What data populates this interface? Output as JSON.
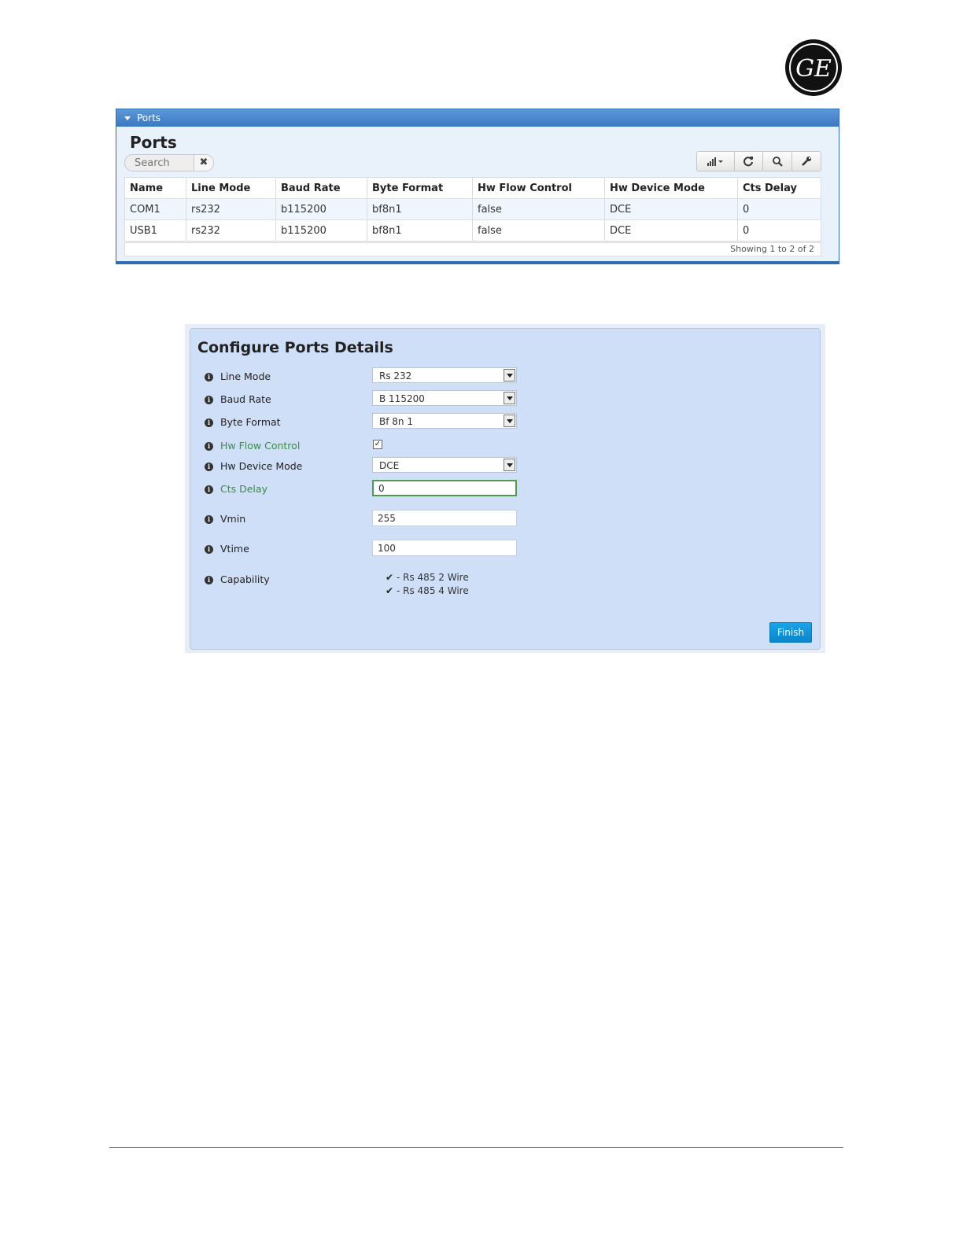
{
  "logo": {
    "text": "GE",
    "icon": "ge-monogram-logo"
  },
  "ports_panel": {
    "header_label": "Ports",
    "title": "Ports",
    "search": {
      "placeholder": "Search",
      "clear_label": "✖"
    },
    "toolbar": [
      "columns-menu-icon",
      "refresh-icon",
      "search-icon",
      "wrench-icon"
    ],
    "columns": [
      "Name",
      "Line Mode",
      "Baud Rate",
      "Byte Format",
      "Hw Flow Control",
      "Hw Device Mode",
      "Cts Delay"
    ],
    "rows": [
      [
        "COM1",
        "rs232",
        "b115200",
        "bf8n1",
        "false",
        "DCE",
        "0"
      ],
      [
        "USB1",
        "rs232",
        "b115200",
        "bf8n1",
        "false",
        "DCE",
        "0"
      ]
    ],
    "showing": "Showing 1 to 2 of 2"
  },
  "configure": {
    "title": "Configure Ports Details",
    "fields": {
      "line_mode": {
        "label": "Line Mode",
        "value": "Rs 232"
      },
      "baud_rate": {
        "label": "Baud Rate",
        "value": "B 115200"
      },
      "byte_format": {
        "label": "Byte Format",
        "value": "Bf 8n 1"
      },
      "hw_flow_control": {
        "label": "Hw Flow Control",
        "checked": true
      },
      "hw_device_mode": {
        "label": "Hw Device Mode",
        "value": "DCE"
      },
      "cts_delay": {
        "label": "Cts Delay",
        "value": "0"
      },
      "vmin": {
        "label": "Vmin",
        "value": "255"
      },
      "vtime": {
        "label": "Vtime",
        "value": "100"
      },
      "capability": {
        "label": "Capability",
        "items": [
          "- Rs 485 2 Wire",
          "- Rs 485 4 Wire"
        ]
      }
    },
    "finish_label": "Finish"
  },
  "colors": {
    "panel_blue": "#3a78c2",
    "form_bg": "#cfdff7",
    "field_green": "#3d8a4a",
    "finish_blue": "#0a86cc"
  }
}
